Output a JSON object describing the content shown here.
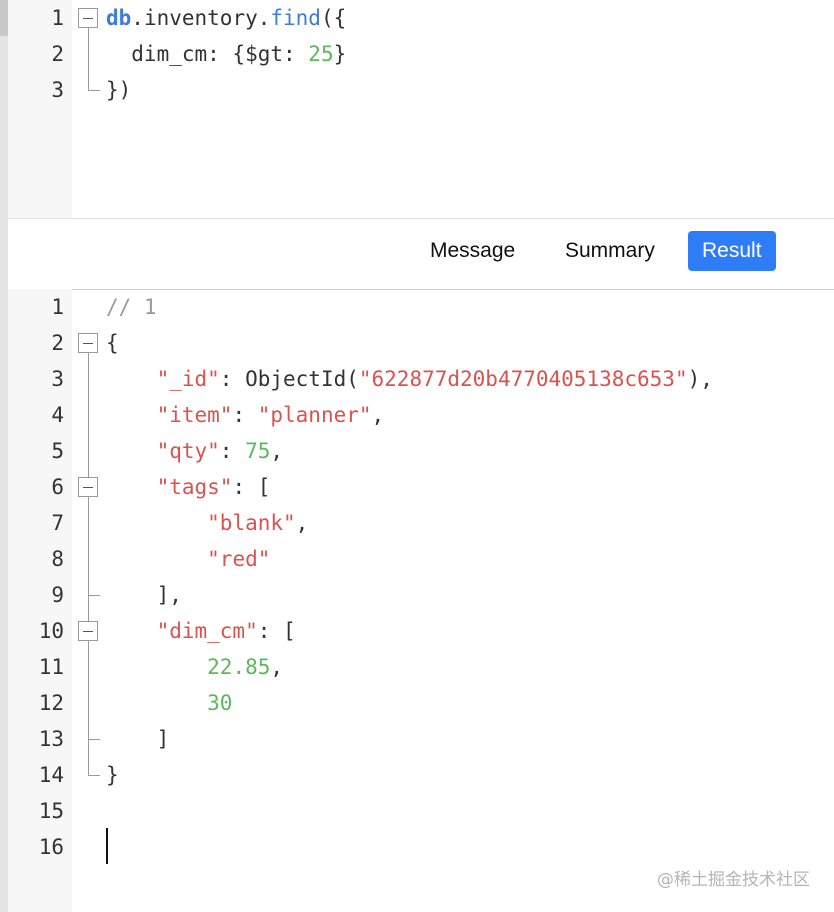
{
  "query_editor": {
    "lines": [
      {
        "n": "1",
        "tokens": [
          {
            "t": "db",
            "c": "kw"
          },
          {
            "t": ".inventory.",
            "c": "plain"
          },
          {
            "t": "find",
            "c": "fn"
          },
          {
            "t": "({",
            "c": "plain"
          }
        ]
      },
      {
        "n": "2",
        "tokens": [
          {
            "t": "  dim_cm: {$gt: ",
            "c": "plain"
          },
          {
            "t": "25",
            "c": "num"
          },
          {
            "t": "}",
            "c": "plain"
          }
        ]
      },
      {
        "n": "3",
        "tokens": [
          {
            "t": "})",
            "c": "plain"
          }
        ]
      }
    ]
  },
  "tabs": [
    {
      "label": "Message",
      "active": false
    },
    {
      "label": "Summary",
      "active": false
    },
    {
      "label": "Result",
      "active": true
    }
  ],
  "result_editor": {
    "lines": [
      {
        "n": "1",
        "tokens": [
          {
            "t": "// 1",
            "c": "cmt"
          }
        ]
      },
      {
        "n": "2",
        "tokens": [
          {
            "t": "{",
            "c": "plain"
          }
        ]
      },
      {
        "n": "3",
        "tokens": [
          {
            "t": "    ",
            "c": "plain"
          },
          {
            "t": "\"_id\"",
            "c": "str"
          },
          {
            "t": ": ObjectId(",
            "c": "plain"
          },
          {
            "t": "\"622877d20b4770405138c653\"",
            "c": "str"
          },
          {
            "t": "),",
            "c": "plain"
          }
        ]
      },
      {
        "n": "4",
        "tokens": [
          {
            "t": "    ",
            "c": "plain"
          },
          {
            "t": "\"item\"",
            "c": "str"
          },
          {
            "t": ": ",
            "c": "plain"
          },
          {
            "t": "\"planner\"",
            "c": "str"
          },
          {
            "t": ",",
            "c": "plain"
          }
        ]
      },
      {
        "n": "5",
        "tokens": [
          {
            "t": "    ",
            "c": "plain"
          },
          {
            "t": "\"qty\"",
            "c": "str"
          },
          {
            "t": ": ",
            "c": "plain"
          },
          {
            "t": "75",
            "c": "num"
          },
          {
            "t": ",",
            "c": "plain"
          }
        ]
      },
      {
        "n": "6",
        "tokens": [
          {
            "t": "    ",
            "c": "plain"
          },
          {
            "t": "\"tags\"",
            "c": "str"
          },
          {
            "t": ": [",
            "c": "plain"
          }
        ]
      },
      {
        "n": "7",
        "tokens": [
          {
            "t": "        ",
            "c": "plain"
          },
          {
            "t": "\"blank\"",
            "c": "str"
          },
          {
            "t": ",",
            "c": "plain"
          }
        ]
      },
      {
        "n": "8",
        "tokens": [
          {
            "t": "        ",
            "c": "plain"
          },
          {
            "t": "\"red\"",
            "c": "str"
          }
        ]
      },
      {
        "n": "9",
        "tokens": [
          {
            "t": "    ],",
            "c": "plain"
          }
        ]
      },
      {
        "n": "10",
        "tokens": [
          {
            "t": "    ",
            "c": "plain"
          },
          {
            "t": "\"dim_cm\"",
            "c": "str"
          },
          {
            "t": ": [",
            "c": "plain"
          }
        ]
      },
      {
        "n": "11",
        "tokens": [
          {
            "t": "        ",
            "c": "plain"
          },
          {
            "t": "22.85",
            "c": "num"
          },
          {
            "t": ",",
            "c": "plain"
          }
        ]
      },
      {
        "n": "12",
        "tokens": [
          {
            "t": "        ",
            "c": "plain"
          },
          {
            "t": "30",
            "c": "num"
          }
        ]
      },
      {
        "n": "13",
        "tokens": [
          {
            "t": "    ]",
            "c": "plain"
          }
        ]
      },
      {
        "n": "14",
        "tokens": [
          {
            "t": "}",
            "c": "plain"
          }
        ]
      },
      {
        "n": "15",
        "tokens": []
      },
      {
        "n": "16",
        "tokens": []
      }
    ]
  },
  "watermark": "@稀土掘金技术社区",
  "colors": {
    "accent": "#2f7df6",
    "keyword": "#3b7dd8",
    "string": "#d9534f",
    "number": "#5cb85c",
    "comment": "#9a9a9a"
  }
}
